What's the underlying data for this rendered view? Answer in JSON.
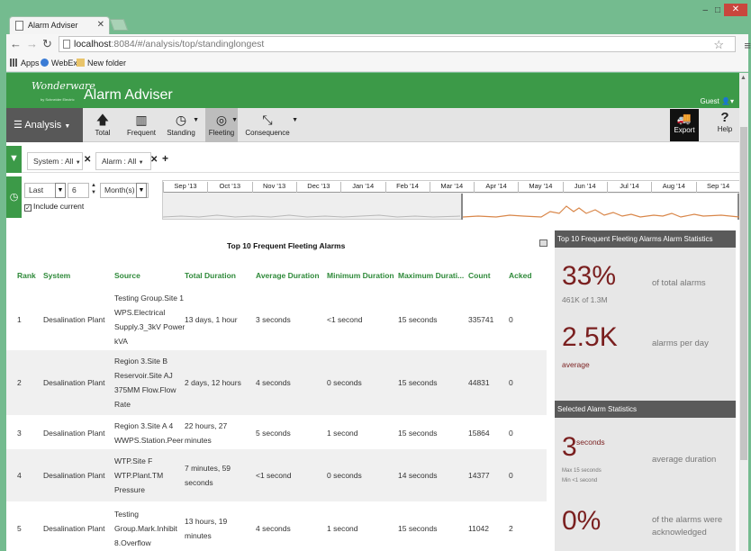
{
  "browser": {
    "tab_title": "Alarm Adviser",
    "url_host": "localhost",
    "url_path": ":8084/#/analysis/top/standinglongest",
    "bookmarks": [
      "Apps",
      "WebEx",
      "New folder"
    ],
    "window_controls": [
      "–",
      "□",
      "✕"
    ]
  },
  "header": {
    "logo": "Wonderware",
    "logo_sub": "by Schneider Electric",
    "title": "Alarm Adviser",
    "user": "Guest"
  },
  "ribbon": {
    "analysis": "Analysis",
    "buttons": [
      {
        "label": "Total",
        "icon": "arrow-up-icon"
      },
      {
        "label": "Frequent",
        "icon": "bar-chart-icon"
      },
      {
        "label": "Standing",
        "icon": "clock-icon"
      },
      {
        "label": "Fleeting",
        "icon": "hidden-eye-icon"
      },
      {
        "label": "Consequence",
        "icon": "collapse-arrows-icon"
      }
    ],
    "export": "Export",
    "help": "Help"
  },
  "filters": {
    "system": "System : All",
    "alarm": "Alarm : All"
  },
  "time": {
    "mode": "Last",
    "count": "6",
    "unit": "Month(s)",
    "include_current": "Include current",
    "months": [
      "Sep '13",
      "Oct '13",
      "Nov '13",
      "Dec '13",
      "Jan '14",
      "Feb '14",
      "Mar '14",
      "Apr '14",
      "May '14",
      "Jun '14",
      "Jul '14",
      "Aug '14",
      "Sep '14"
    ]
  },
  "table": {
    "title": "Top 10 Frequent Fleeting Alarms",
    "headers": [
      "Rank",
      "System",
      "Source",
      "Total Duration",
      "Average Duration",
      "Minimum Duration",
      "Maximum Durati...",
      "Count",
      "Acked"
    ],
    "rows": [
      {
        "rank": "1",
        "system": "Desalination Plant",
        "source": [
          "Testing Group.Site 1",
          "WPS.Electrical",
          "Supply.3_3kV Power",
          "kVA"
        ],
        "total": [
          "13 days, 1 hour"
        ],
        "avg": "3 seconds",
        "min": "<1 second",
        "max": "15 seconds",
        "count": "335741",
        "acked": "0"
      },
      {
        "rank": "2",
        "system": "Desalination Plant",
        "source": [
          "Region 3.Site B",
          "Reservoir.Site AJ",
          "375MM Flow.Flow",
          "Rate"
        ],
        "total": [
          "2 days, 12 hours"
        ],
        "avg": "4 seconds",
        "min": "0 seconds",
        "max": "15 seconds",
        "count": "44831",
        "acked": "0"
      },
      {
        "rank": "3",
        "system": "Desalination Plant",
        "source": [
          "Region 3.Site A 4",
          "WWPS.Station.Peer"
        ],
        "total": [
          "22 hours, 27",
          "minutes"
        ],
        "avg": "5 seconds",
        "min": "1 second",
        "max": "15 seconds",
        "count": "15864",
        "acked": "0"
      },
      {
        "rank": "4",
        "system": "Desalination Plant",
        "source": [
          "WTP.Site F",
          "WTP.Plant.TM",
          "Pressure"
        ],
        "total": [
          "7 minutes, 59",
          "seconds"
        ],
        "avg": "<1 second",
        "min": "0 seconds",
        "max": "14 seconds",
        "count": "14377",
        "acked": "0"
      },
      {
        "rank": "5",
        "system": "Desalination Plant",
        "source": [
          "Testing",
          "Group.Mark.Inhibit",
          "8.Overflow"
        ],
        "total": [
          "13 hours, 19",
          "minutes"
        ],
        "avg": "4 seconds",
        "min": "1 second",
        "max": "15 seconds",
        "count": "11042",
        "acked": "2"
      }
    ]
  },
  "stats": {
    "head1": "Top 10 Frequent Fleeting Alarms Alarm Statistics",
    "pct": "33%",
    "pct_sub": "461K of 1.3M",
    "pct_desc": "of total alarms",
    "rate": "2.5K",
    "rate_sub": "average",
    "rate_desc": "alarms per day",
    "head2": "Selected Alarm Statistics",
    "dur": "3",
    "dur_unit": "seconds",
    "dur_max": "Max 15 seconds",
    "dur_min": "Min <1 second",
    "dur_desc": "average duration",
    "ack": "0%",
    "ack_desc1": "of the alarms were",
    "ack_desc2": "acknowledged"
  }
}
